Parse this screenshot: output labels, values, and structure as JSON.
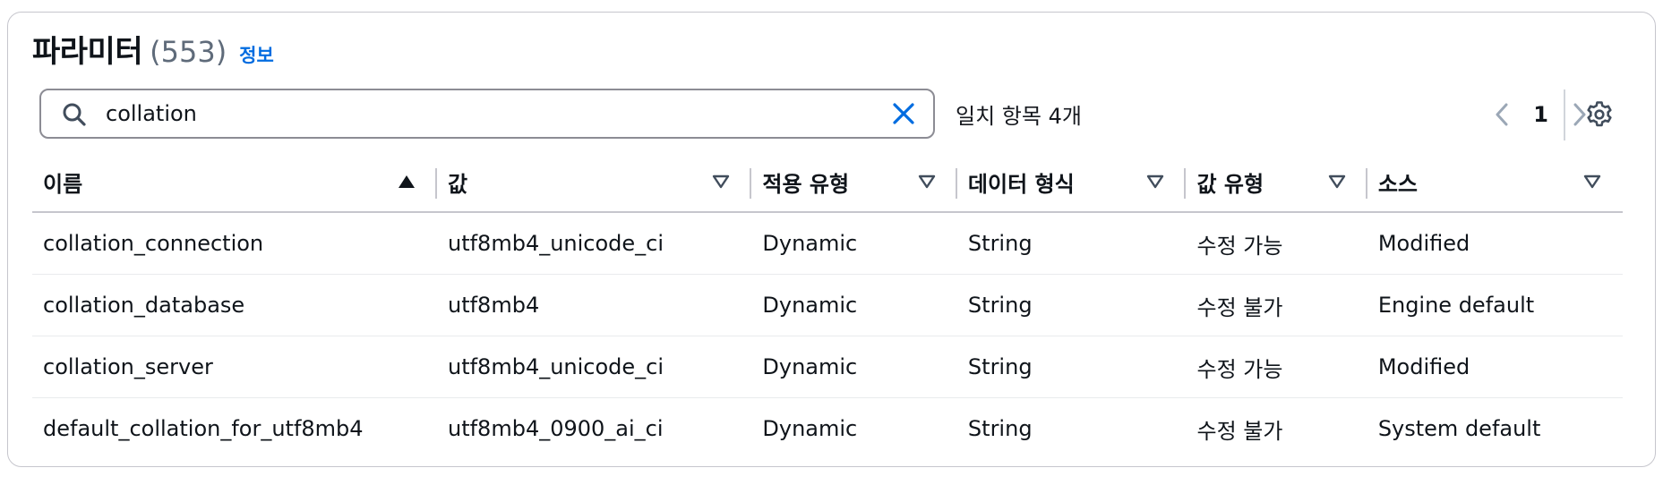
{
  "header": {
    "title": "파라미터",
    "count": "(553)",
    "info_link": "정보"
  },
  "search": {
    "value": "collation",
    "placeholder": "",
    "match_count": "일치 항목 4개"
  },
  "pagination": {
    "current_page": "1"
  },
  "table": {
    "columns": [
      {
        "label": "이름",
        "sort": "ascending"
      },
      {
        "label": "값",
        "sort": "none"
      },
      {
        "label": "적용 유형",
        "sort": "none"
      },
      {
        "label": "데이터 형식",
        "sort": "none"
      },
      {
        "label": "값 유형",
        "sort": "none"
      },
      {
        "label": "소스",
        "sort": "none"
      }
    ],
    "rows": [
      [
        "collation_connection",
        "utf8mb4_unicode_ci",
        "Dynamic",
        "String",
        "수정 가능",
        "Modified"
      ],
      [
        "collation_database",
        "utf8mb4",
        "Dynamic",
        "String",
        "수정 불가",
        "Engine default"
      ],
      [
        "collation_server",
        "utf8mb4_unicode_ci",
        "Dynamic",
        "String",
        "수정 가능",
        "Modified"
      ],
      [
        "default_collation_for_utf8mb4",
        "utf8mb4_0900_ai_ci",
        "Dynamic",
        "String",
        "수정 불가",
        "System default"
      ]
    ]
  },
  "icons": {
    "search": "search-icon",
    "clear": "close-icon",
    "prev": "chevron-left-icon",
    "next": "chevron-right-icon",
    "settings": "gear-icon",
    "sort_asc": "sort-ascending-icon",
    "sort_none": "sort-descending-outline-icon"
  },
  "colors": {
    "link": "#006ce0",
    "clear_icon": "#006ce0",
    "border": "#c6c6cd",
    "text": "#0f141a",
    "muted": "#5f6b7a"
  }
}
